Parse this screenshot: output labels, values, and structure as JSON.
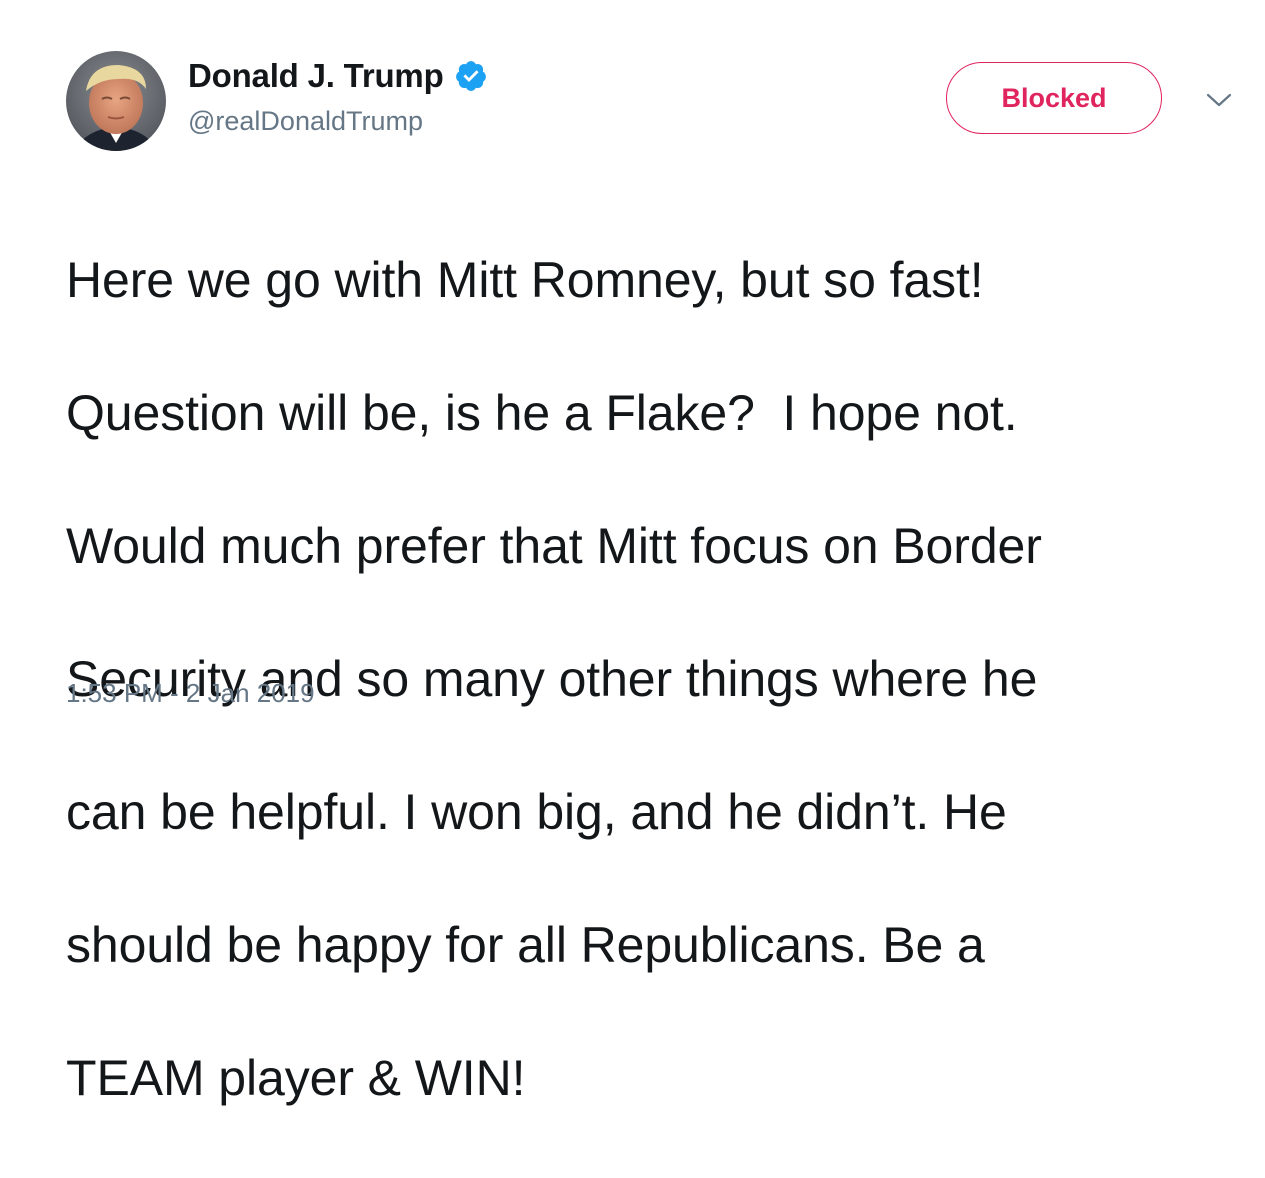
{
  "author": {
    "display_name": "Donald J. Trump",
    "handle": "@realDonaldTrump",
    "verified": true
  },
  "actions": {
    "follow_state_label": "Blocked",
    "menu_icon": "chevron-down-icon"
  },
  "tweet": {
    "lines": [
      "Here we go with Mitt Romney, but so fast!",
      "Question will be, is he a Flake?  I hope not.",
      "Would much prefer that Mitt focus on Border",
      "Security and so many other things where he",
      "can be helpful. I won big, and he didn’t. He",
      "should be happy for all Republicans. Be a",
      "TEAM player & WIN!"
    ],
    "timestamp": "1:53 PM - 2 Jan 2019"
  },
  "colors": {
    "text_primary": "#14171a",
    "text_secondary": "#657786",
    "blocked_red": "#e0245e",
    "verified_blue": "#1da1f2"
  }
}
